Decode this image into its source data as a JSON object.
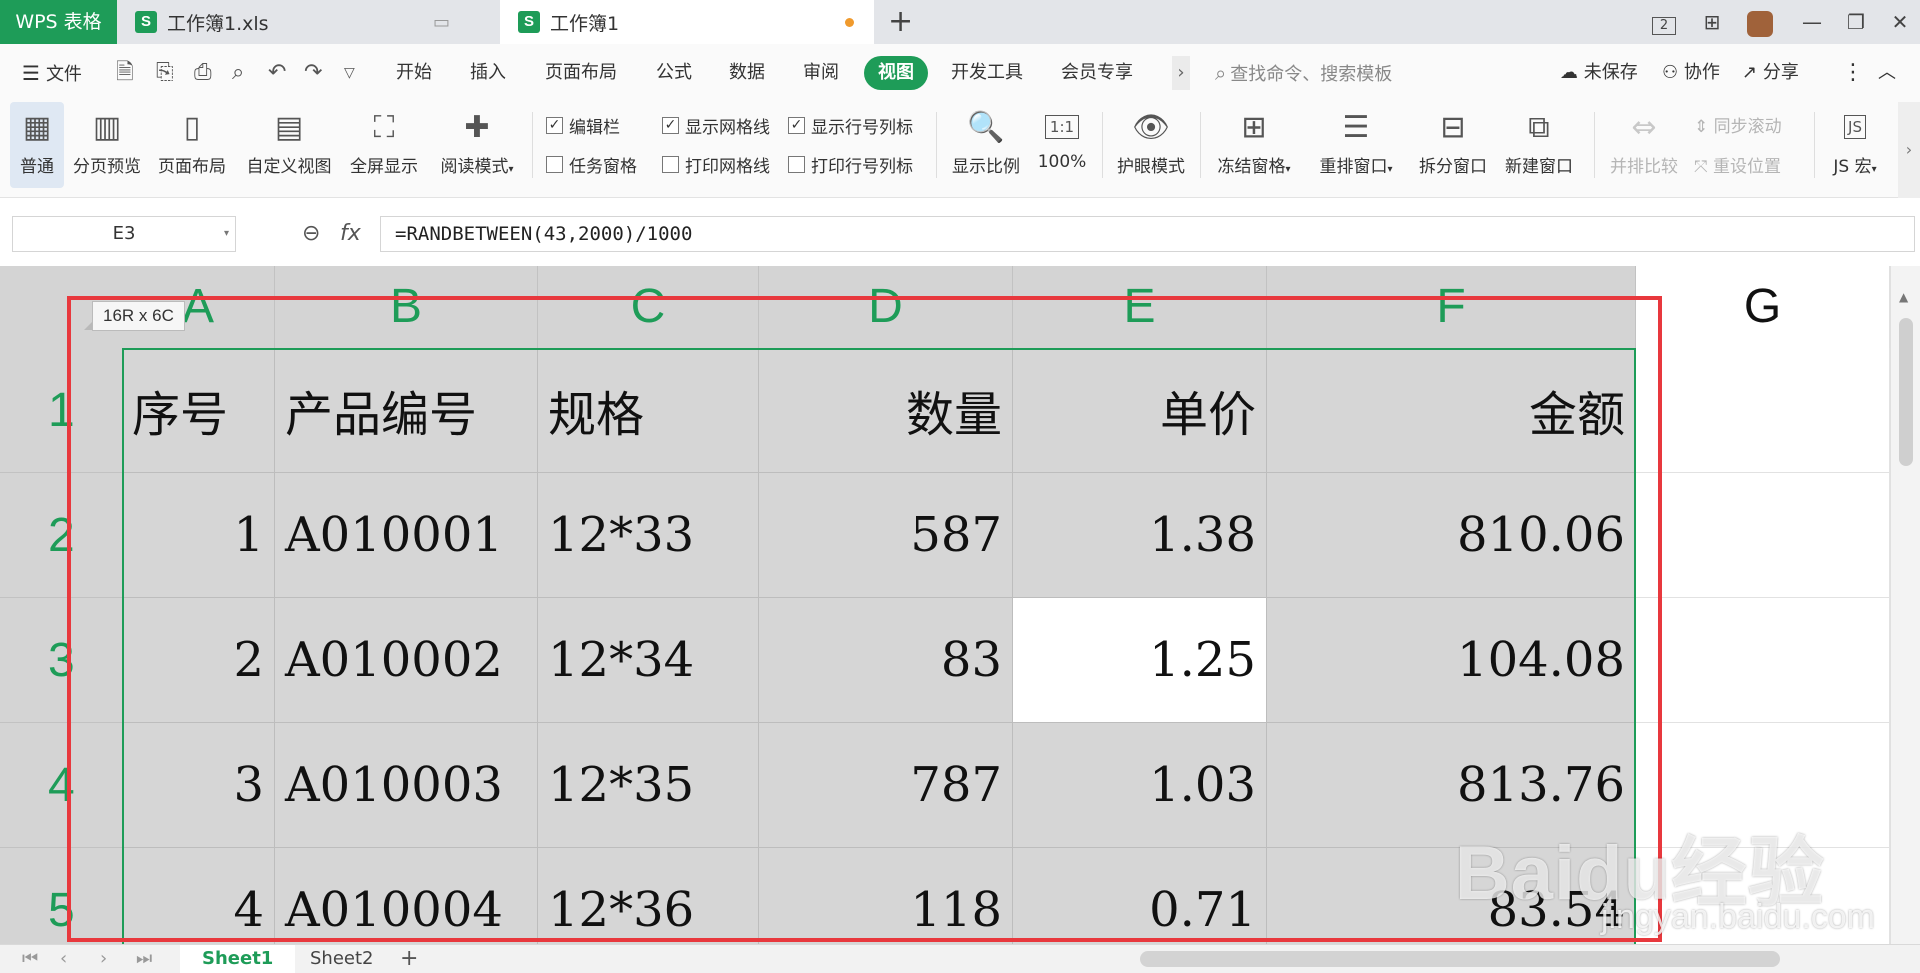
{
  "app": {
    "app_tab": "WPS 表格",
    "tabs": [
      {
        "label": "工作簿1.xls"
      },
      {
        "label": "工作簿1"
      }
    ],
    "new_tab_symbol": "+"
  },
  "window_controls": {
    "badge": "2"
  },
  "menu": {
    "file_label": "文件",
    "tabs": [
      "开始",
      "插入",
      "页面布局",
      "公式",
      "数据",
      "审阅",
      "视图",
      "开发工具",
      "会员专享"
    ],
    "active_tab": "视图",
    "more": "›",
    "search_placeholder": "查找命令、搜索模板",
    "unsaved_label": "未保存",
    "collab_label": "协作",
    "share_label": "分享"
  },
  "ribbon": {
    "normal_label": "普通",
    "page_break_label": "分页预览",
    "page_layout_label": "页面布局",
    "custom_view_label": "自定义视图",
    "fullscreen_label": "全屏显示",
    "reading_mode_label": "阅读模式",
    "formula_bar_label": "编辑栏",
    "gridlines_label": "显示网格线",
    "headings_label": "显示行号列标",
    "task_pane_label": "任务窗格",
    "print_grid_label": "打印网格线",
    "print_headings_label": "打印行号列标",
    "zoom_label": "显示比例",
    "zoom100_label": "100%",
    "zoom100_icon_text": "1:1",
    "eye_label": "护眼模式",
    "freeze_label": "冻结窗格",
    "arrange_label": "重排窗口",
    "split_label": "拆分窗口",
    "new_window_label": "新建窗口",
    "side_by_side_label": "并排比较",
    "sync_scroll_label": "同步滚动",
    "reset_pos_label": "重设位置",
    "macro_label": "JS 宏"
  },
  "formula_bar": {
    "cell_ref": "E3",
    "fx_label": "fx",
    "formula": "=RANDBETWEEN(43,2000)/1000"
  },
  "sheet": {
    "selection_tip": "16R x 6C",
    "columns": [
      "A",
      "B",
      "C",
      "D",
      "E",
      "F",
      "G"
    ],
    "rows": [
      "1",
      "2",
      "3",
      "4",
      "5"
    ],
    "header_row": [
      "序号",
      "产品编号",
      "规格",
      "数量",
      "单价",
      "金额"
    ],
    "data_rows": [
      [
        "1",
        "A010001",
        "12*33",
        "587",
        "1.38",
        "810.06"
      ],
      [
        "2",
        "A010002",
        "12*34",
        "83",
        "1.25",
        "104.08"
      ],
      [
        "3",
        "A010003",
        "12*35",
        "787",
        "1.03",
        "813.76"
      ],
      [
        "4",
        "A010004",
        "12*36",
        "118",
        "0.71",
        "83.54"
      ]
    ],
    "active_cell": "E3"
  },
  "watermark": {
    "brand": "Baidu经验",
    "url": "jingyan.baidu.com"
  },
  "sheet_tabs": {
    "tabs": [
      "Sheet1",
      "Sheet2"
    ],
    "active": "Sheet1",
    "add": "+"
  },
  "colors": {
    "accent": "#1e9c58",
    "highlight": "#e8383d",
    "selection_fill": "#d6d6d6"
  }
}
